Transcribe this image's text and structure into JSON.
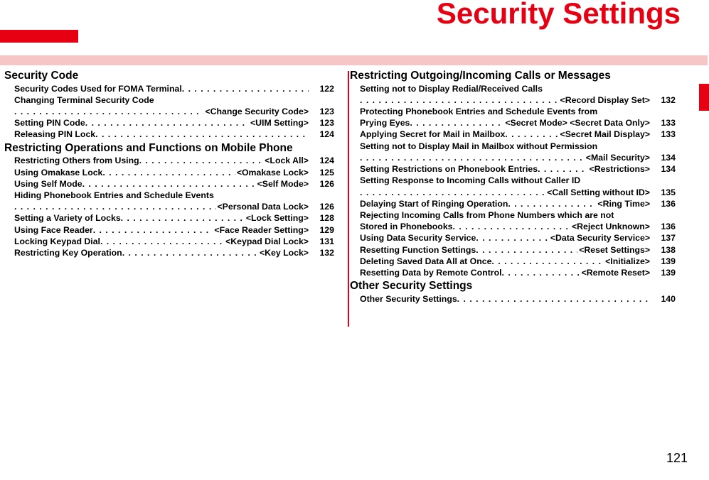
{
  "title": "Security Settings",
  "page_number": "121",
  "left": {
    "sections": [
      {
        "heading": "Security Code",
        "items": [
          {
            "label": "Security Codes Used for FOMA Terminal",
            "tag": "",
            "page": "122"
          },
          {
            "label": "Changing Terminal Security Code",
            "cont": true
          },
          {
            "label": "",
            "tag": "<Change Security Code>",
            "page": "123"
          },
          {
            "label": "Setting PIN Code",
            "tag": "<UIM Setting>",
            "page": "123"
          },
          {
            "label": "Releasing PIN Lock",
            "tag": "",
            "page": "124"
          }
        ]
      },
      {
        "heading": "Restricting Operations and Functions on Mobile Phone",
        "items": [
          {
            "label": "Restricting Others from Using",
            "tag": "<Lock All>",
            "page": "124"
          },
          {
            "label": "Using Omakase Lock",
            "tag": "<Omakase Lock>",
            "page": "125"
          },
          {
            "label": "Using Self Mode",
            "tag": "<Self Mode>",
            "page": "126"
          },
          {
            "label": "Hiding Phonebook Entries and Schedule Events",
            "cont": true
          },
          {
            "label": "",
            "tag": "<Personal Data Lock>",
            "page": "126"
          },
          {
            "label": "Setting a Variety of Locks",
            "tag": "<Lock Setting>",
            "page": "128"
          },
          {
            "label": "Using Face Reader",
            "tag": "<Face Reader Setting>",
            "page": "129"
          },
          {
            "label": "Locking Keypad Dial",
            "tag": "<Keypad Dial Lock>",
            "page": "131"
          },
          {
            "label": "Restricting Key Operation",
            "tag": "<Key Lock>",
            "page": "132"
          }
        ]
      }
    ]
  },
  "right": {
    "sections": [
      {
        "heading": "Restricting Outgoing/Incoming Calls or Messages",
        "items": [
          {
            "label": "Setting not to Display Redial/Received Calls",
            "cont": true
          },
          {
            "label": "",
            "tag": "<Record Display Set>",
            "page": "132"
          },
          {
            "label": "Protecting Phonebook Entries and Schedule Events from",
            "cont": true
          },
          {
            "label": "Prying Eyes",
            "tag": "<Secret Mode> <Secret Data Only>",
            "page": "133"
          },
          {
            "label": "Applying Secret for Mail in Mailbox",
            "tag": "<Secret Mail Display>",
            "page": "133"
          },
          {
            "label": "Setting not to Display Mail in Mailbox without Permission",
            "cont": true
          },
          {
            "label": "",
            "tag": "<Mail Security>",
            "page": "134"
          },
          {
            "label": "Setting Restrictions on Phonebook Entries",
            "tag": "<Restrictions>",
            "page": "134"
          },
          {
            "label": "Setting Response to Incoming Calls without Caller ID",
            "cont": true
          },
          {
            "label": "",
            "tag": "<Call Setting without ID>",
            "page": "135"
          },
          {
            "label": "Delaying Start of Ringing Operation",
            "tag": "<Ring Time>",
            "page": "136"
          },
          {
            "label": "Rejecting Incoming Calls from Phone Numbers which are not",
            "cont": true
          },
          {
            "label": "Stored in Phonebooks",
            "tag": "<Reject Unknown>",
            "page": "136"
          },
          {
            "label": "Using Data Security Service",
            "tag": "<Data Security Service>",
            "page": "137"
          },
          {
            "label": "Resetting Function Settings",
            "tag": "<Reset Settings>",
            "page": "138"
          },
          {
            "label": "Deleting Saved Data All at Once",
            "tag": "<Initialize>",
            "page": "139"
          },
          {
            "label": "Resetting Data by Remote Control",
            "tag": "<Remote Reset>",
            "page": "139"
          }
        ]
      },
      {
        "heading": "Other Security Settings",
        "items": [
          {
            "label": "Other Security Settings",
            "tag": "",
            "page": "140"
          }
        ]
      }
    ]
  }
}
